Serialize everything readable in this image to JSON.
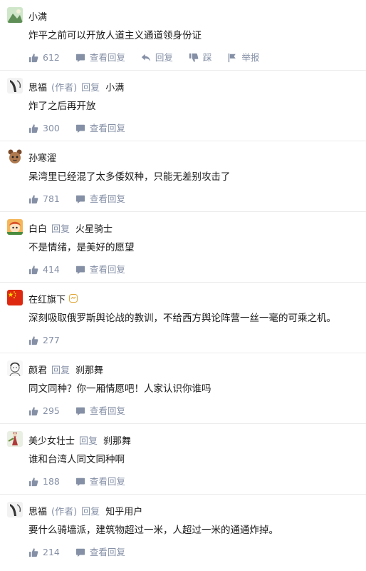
{
  "comments": [
    {
      "name": "小满",
      "content": "炸平之前可以开放人道主义通道领身份证",
      "likes": "612",
      "actions": {
        "view": "查看回复",
        "reply": "回复",
        "dislike": "踩",
        "report": "举报"
      }
    },
    {
      "name": "思福",
      "tag": "(作者)",
      "reply_word": "回复",
      "reply_to": "小满",
      "content": "炸了之后再开放",
      "likes": "300",
      "view": "查看回复"
    },
    {
      "name": "孙寒濯",
      "content": "呆湾里已经混了太多倭奴种，只能无差别攻击了",
      "likes": "781",
      "view": "查看回复"
    },
    {
      "name": "白白",
      "reply_word": "回复",
      "reply_to": "火星骑士",
      "content": "不是情绪，是美好的愿望",
      "likes": "414",
      "view": "查看回复"
    },
    {
      "name": "在红旗下",
      "content": "深刻吸取俄罗斯舆论战的教训，不给西方舆论阵营一丝一毫的可乘之机。",
      "likes": "277"
    },
    {
      "name": "颜君",
      "reply_word": "回复",
      "reply_to": "刹那舞",
      "content": "同文同种？你一厢情愿吧！人家认识你谁吗",
      "likes": "295",
      "view": "查看回复"
    },
    {
      "name": "美少女壮士",
      "reply_word": "回复",
      "reply_to": "刹那舞",
      "content": "谁和台湾人同文同种啊",
      "likes": "188",
      "view": "查看回复"
    },
    {
      "name": "思福",
      "tag": "(作者)",
      "reply_word": "回复",
      "reply_to": "知乎用户",
      "content": "要什么骑墙派，建筑物超过一米，人超过一米的通通炸掉。",
      "likes": "214",
      "view": "查看回复"
    }
  ],
  "colors": {
    "meta": "#8590a6",
    "text": "#1a1a1a",
    "divider": "#ececec"
  }
}
